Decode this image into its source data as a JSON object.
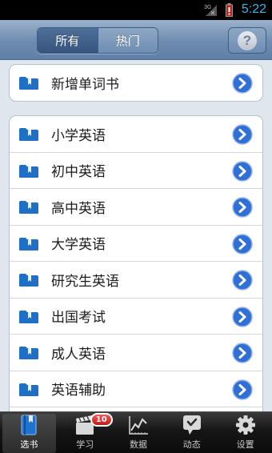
{
  "status_bar": {
    "network": "3G",
    "time": "5:22"
  },
  "segment": {
    "all_label": "所有",
    "hot_label": "热门",
    "active": "all"
  },
  "help": {
    "symbol": "?"
  },
  "new_book": {
    "label": "新增单词书"
  },
  "categories": [
    {
      "label": "小学英语"
    },
    {
      "label": "初中英语"
    },
    {
      "label": "高中英语"
    },
    {
      "label": "大学英语"
    },
    {
      "label": "研究生英语"
    },
    {
      "label": "出国考试"
    },
    {
      "label": "成人英语"
    },
    {
      "label": "英语辅助"
    }
  ],
  "tabs": [
    {
      "label": "选书",
      "icon": "book-icon",
      "active": true
    },
    {
      "label": "学习",
      "icon": "clapper-icon",
      "badge": "10"
    },
    {
      "label": "数据",
      "icon": "chart-icon"
    },
    {
      "label": "动态",
      "icon": "speech-bubble-icon"
    },
    {
      "label": "设置",
      "icon": "gear-icon"
    }
  ],
  "colors": {
    "accent": "#2f6fd6",
    "folder": "#1f6fc4",
    "topbar": "#6e8cb0",
    "badge": "#d32222"
  }
}
